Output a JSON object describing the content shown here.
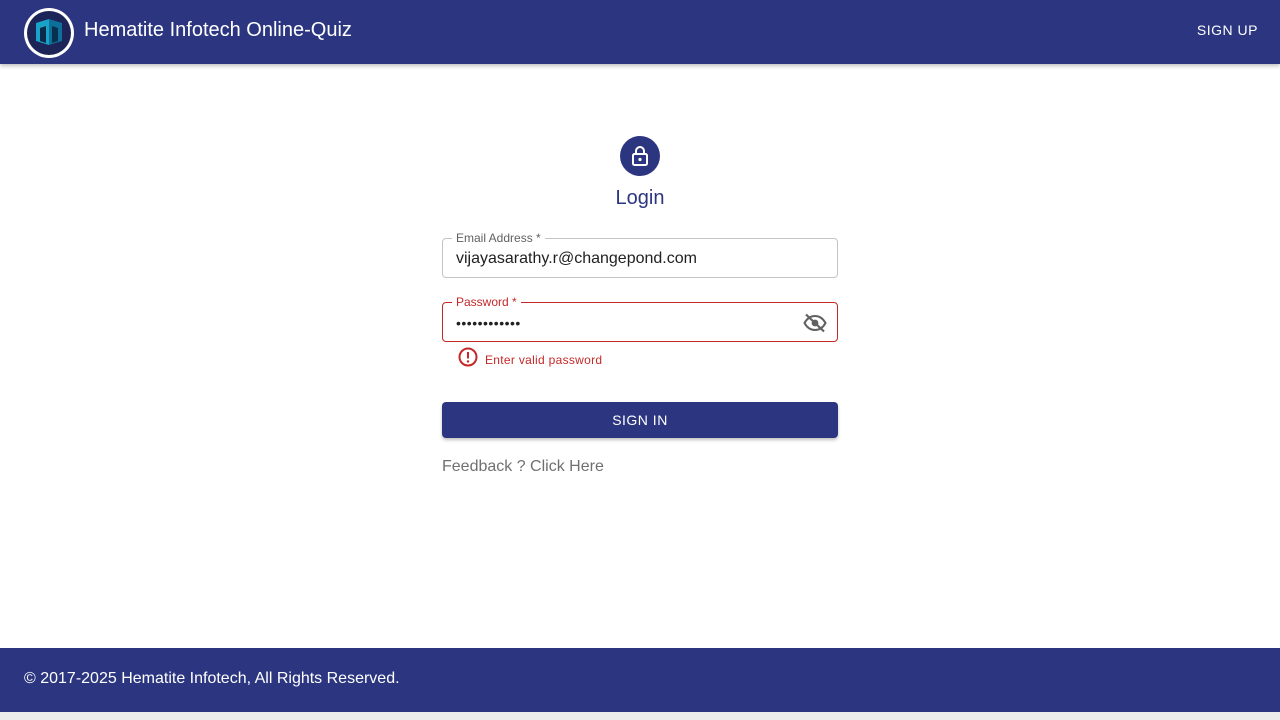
{
  "header": {
    "app_title": "Hematite Infotech Online-Quiz",
    "signup_label": "SIGN UP",
    "logo_icon": "hematite-logo-icon"
  },
  "login": {
    "title": "Login",
    "lock_icon": "lock-icon",
    "email": {
      "label": "Email Address *",
      "value": "vijayasarathy.r@changepond.com"
    },
    "password": {
      "label": "Password *",
      "masked_value": "••••••••••••",
      "visibility_icon": "eye-off-icon",
      "error": "Enter valid password",
      "error_icon": "error-circle-icon"
    },
    "signin_label": "SIGN IN",
    "feedback_label": "Feedback ? Click Here"
  },
  "footer": {
    "copyright": "© 2017-2025 Hematite Infotech, All Rights Reserved."
  },
  "colors": {
    "primary": "#2c3680",
    "error": "#c62828",
    "muted_text": "#707070"
  }
}
